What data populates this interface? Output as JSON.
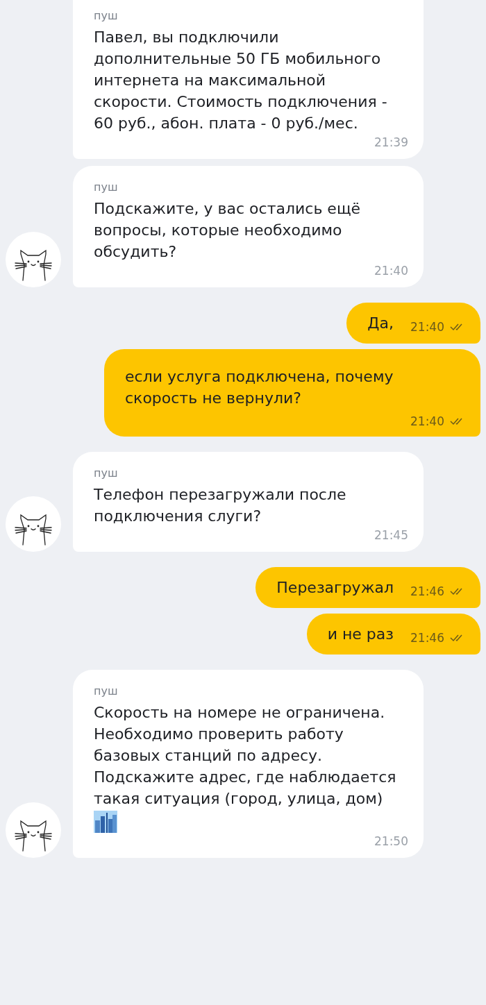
{
  "messages": [
    {
      "kind": "incoming",
      "sender": "пуш",
      "text": "Павел, вы подключили дополнительные 50 ГБ мобильного интернета на максимальной скорости. Стоимость подключения - 60 руб., абон. плата - 0 руб./мес.",
      "time": "21:39",
      "avatar": false,
      "emoji": false
    },
    {
      "kind": "incoming",
      "sender": "пуш",
      "text": "Подскажите, у вас остались ещё вопросы, которые необходимо обсудить?",
      "time": "21:40",
      "avatar": true,
      "emoji": false
    },
    {
      "kind": "outgoing",
      "text": "Да,",
      "time": "21:40",
      "read": true
    },
    {
      "kind": "outgoing",
      "text": "если услуга подключена, почему скорость не вернули?",
      "time": "21:40",
      "read": true
    },
    {
      "kind": "incoming",
      "sender": "пуш",
      "text": "Телефон перезагружали после подключения слуги?",
      "time": "21:45",
      "avatar": true,
      "emoji": false
    },
    {
      "kind": "outgoing",
      "text": "Перезагружал",
      "time": "21:46",
      "read": true
    },
    {
      "kind": "outgoing",
      "text": "и не раз",
      "time": "21:46",
      "read": true
    },
    {
      "kind": "incoming",
      "sender": "пуш",
      "text": "Скорость на номере не ограничена. Необходимо проверить работу базовых станций по адресу. Подскажите адрес, где наблюдается такая ситуация (город, улица, дом)",
      "time": "21:50",
      "avatar": true,
      "emoji": true
    }
  ]
}
